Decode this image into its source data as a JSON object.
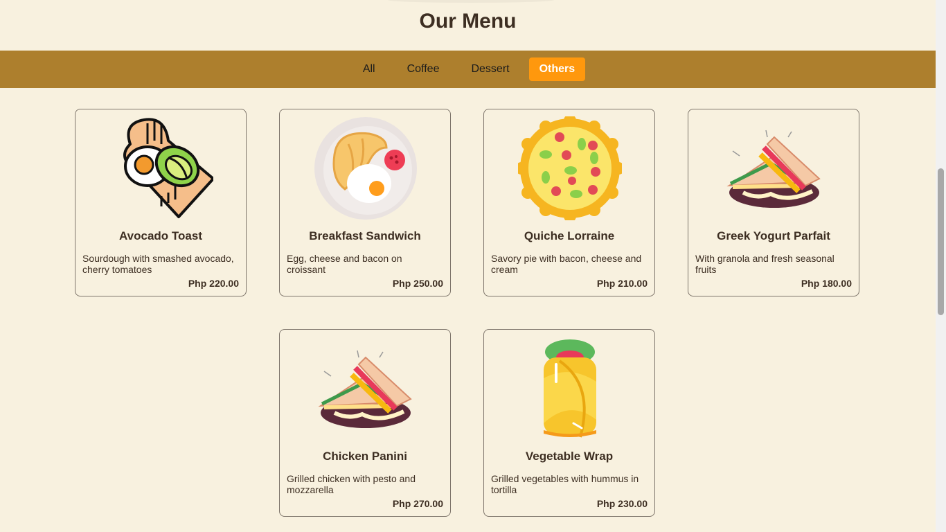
{
  "page": {
    "title": "Our Menu"
  },
  "nav": {
    "tabs": [
      {
        "label": "All",
        "active": false
      },
      {
        "label": "Coffee",
        "active": false
      },
      {
        "label": "Dessert",
        "active": false
      },
      {
        "label": "Others",
        "active": true
      }
    ]
  },
  "colors": {
    "background": "#f8f1df",
    "nav_bar": "#ad7f2d",
    "active_tab": "#ff980d",
    "text": "#3d2e22"
  },
  "items": [
    {
      "name": "Avocado Toast",
      "description": "Sourdough with smashed avocado, cherry tomatoes",
      "price": "Php 220.00",
      "icon": "avocado-toast-icon"
    },
    {
      "name": "Breakfast Sandwich",
      "description": "Egg, cheese and bacon on croissant",
      "price": "Php 250.00",
      "icon": "croissant-plate-icon"
    },
    {
      "name": "Quiche Lorraine",
      "description": "Savory pie with bacon, cheese and cream",
      "price": "Php 210.00",
      "icon": "pie-icon"
    },
    {
      "name": "Greek Yogurt Parfait",
      "description": "With granola and fresh seasonal fruits",
      "price": "Php 180.00",
      "icon": "sandwich-icon"
    },
    {
      "name": "Chicken Panini",
      "description": "Grilled chicken with pesto and mozzarella",
      "price": "Php 270.00",
      "icon": "sandwich-icon"
    },
    {
      "name": "Vegetable Wrap",
      "description": "Grilled vegetables with hummus in tortilla",
      "price": "Php 230.00",
      "icon": "burrito-icon"
    }
  ]
}
